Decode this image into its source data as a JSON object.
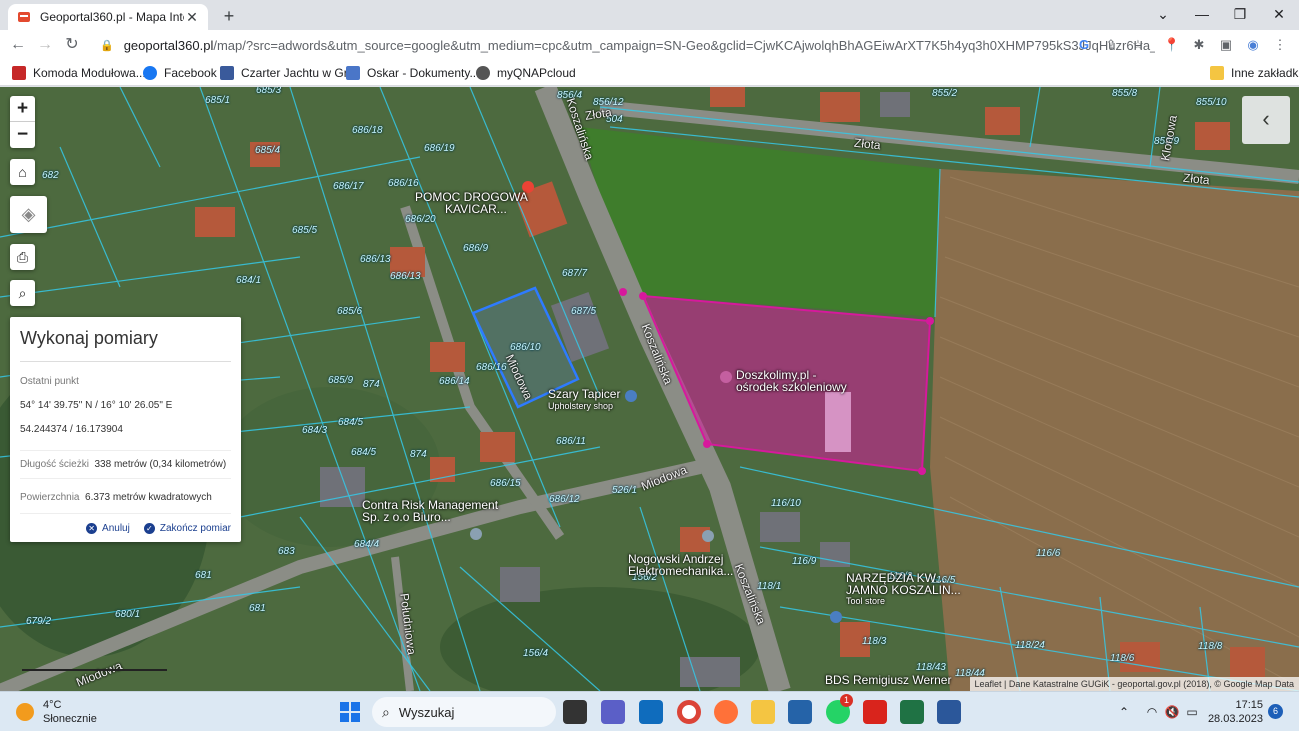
{
  "browser": {
    "tab_title": "Geoportal360.pl - Mapa Interakt",
    "tab_close": "✕",
    "new_tab": "+",
    "url_host": "geoportal360.pl",
    "url_rest": "/map/?src=adwords&utm_source=google&utm_medium=cpc&utm_campaign=SN-Geo&gclid=CjwKCAjwolqhBhAGEiwArXT7K5h4yq3h0XHMP795kS3JJqHuzr6Ha_l...",
    "bookmarks": [
      "Komoda Modułowa...",
      "Facebook",
      "Czarter Jachtu w Gr...",
      "Oskar - Dokumenty...",
      "myQNAPcloud"
    ],
    "other_bookmarks": "Inne zakładki"
  },
  "map": {
    "zoom_in": "+",
    "zoom_out": "−",
    "parcels": [
      "685/1",
      "686/18",
      "686/19",
      "685/4",
      "682",
      "686/17",
      "686/16",
      "686/20",
      "685/5",
      "686/9",
      "686/13",
      "686/13",
      "684/1",
      "685/6",
      "687/7",
      "687/5",
      "686/10",
      "686/16",
      "686/14",
      "685/9",
      "874",
      "684/5",
      "684/3",
      "684/5",
      "874",
      "686/11",
      "686/15",
      "686/12",
      "526/1",
      "684/4",
      "683",
      "681",
      "681",
      "679/2",
      "680/1",
      "156/4",
      "156/2",
      "116/10",
      "116/9",
      "118/1",
      "116/2",
      "116/5",
      "116/6",
      "118/3",
      "118/24",
      "118/6",
      "118/8",
      "118/43",
      "118/44",
      "855/2",
      "855/8",
      "855/10",
      "855/9",
      "856/4",
      "856/12",
      "504",
      "685/3"
    ],
    "streets": [
      "Złota",
      "Złota",
      "Złota",
      "Koszalińska",
      "Koszalińska",
      "Koszalińska",
      "Miodowa",
      "Miodowa",
      "Miodowa",
      "Południowa",
      "Klonowa"
    ],
    "pois": [
      {
        "name": "POMOC DROGOWA",
        "sub": "KAVICAR..."
      },
      {
        "name": "Doszkolimy.pl -",
        "sub": "ośrodek szkoleniowy"
      },
      {
        "name": "Szary Tapicer",
        "sub": "Upholstery shop"
      },
      {
        "name": "Contra Risk Management",
        "sub": "Sp. z o.o Biuro..."
      },
      {
        "name": "Nogowski Andrzej",
        "sub": "Elektromechanika..."
      },
      {
        "name": "NARZĘDZIA KW...",
        "sub": "JAMNO KOSZALIN..."
      },
      {
        "name": "Tool store",
        "sub": ""
      },
      {
        "name": "BDS Remigiusz Werner",
        "sub": ""
      }
    ],
    "attribution": "Leaflet | Dane Katastralne GUGiK - geoportal.gov.pl (2018), © Google Map Data",
    "colors": {
      "measure_polygon": "#d6199c",
      "selected_parcel": "#2e7bff",
      "parcel_lines": "#35c9e8"
    }
  },
  "measure_panel": {
    "title": "Wykonaj pomiary",
    "last_point_label": "Ostatni punkt",
    "coords_dms": "54° 14' 39.75\" N / 16° 10' 26.05\" E",
    "coords_dec": "54.244374 / 16.173904",
    "path_label": "Długość ścieżki",
    "path_value": "338 metrów (0,34 kilometrów)",
    "area_label": "Powierzchnia",
    "area_value": "6.373 metrów kwadratowych",
    "cancel": "Anuluj",
    "finish": "Zakończ pomiar"
  },
  "taskbar": {
    "temp": "4°C",
    "weather": "Słonecznie",
    "search": "Wyszukaj",
    "time": "17:15",
    "date": "28.03.2023",
    "notifications": "6",
    "whatsapp_badge": "1"
  }
}
